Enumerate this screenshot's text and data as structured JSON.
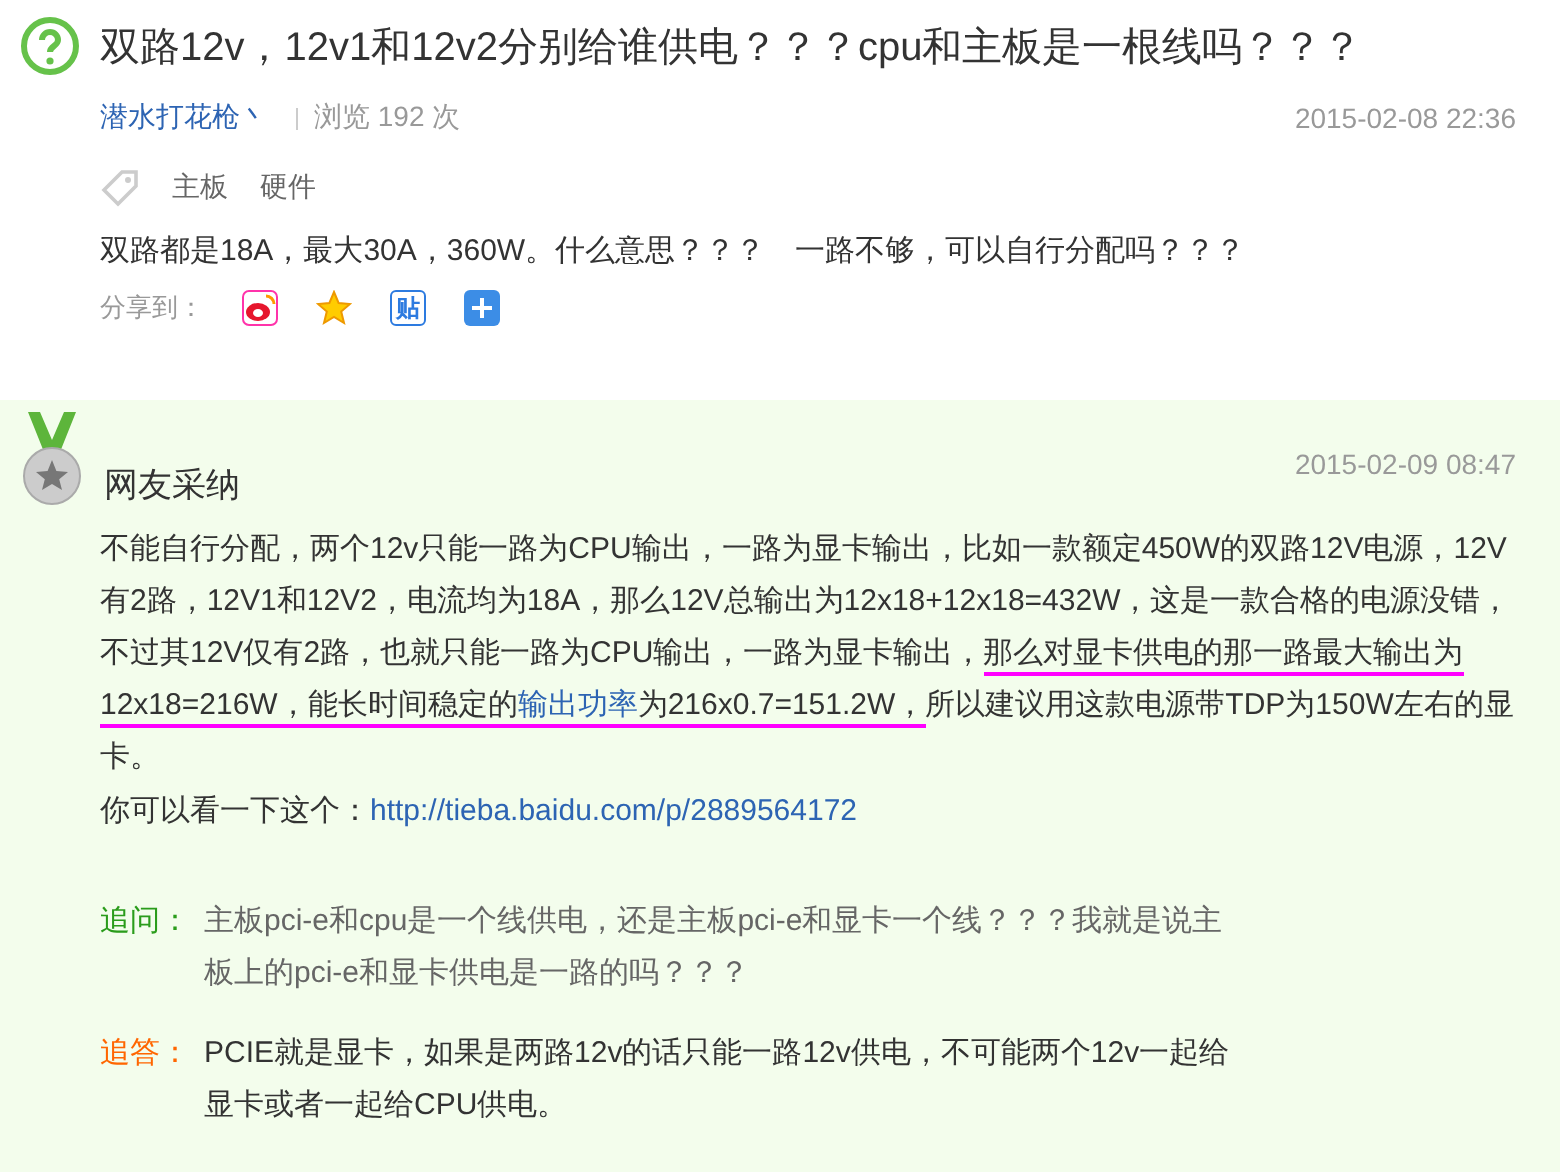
{
  "question": {
    "title": "双路12v，12v1和12v2分别给谁供电？？？cpu和主板是一根线吗？？？",
    "author": "潜水打花枪丶",
    "views": "浏览 192 次",
    "date": "2015-02-08 22:36",
    "tags": [
      "主板",
      "硬件"
    ],
    "text": "双路都是18A，最大30A，360W。什么意思？？？　一路不够，可以自行分配吗？？？",
    "share_label": "分享到：",
    "share": [
      {
        "kind": "weibo"
      },
      {
        "kind": "qzone"
      },
      {
        "kind": "tieba",
        "glyph": "贴"
      },
      {
        "kind": "more"
      }
    ]
  },
  "answer": {
    "heading": "网友采纳",
    "date": "2015-02-09 08:47",
    "segments": [
      {
        "kind": "plain",
        "text": "不能自行分配，两个12v只能一路为CPU输出，一路为显卡输出，比如一款额定450W的双路12V电源，12V有2路，12V1和12V2，电流均为18A，那么12V总输出为12x18+12x18=432W，这是一款合格的电源没错，不过其12V仅有2路，也就只能一路为CPU输出，一路为显卡输出，"
      },
      {
        "kind": "underline",
        "text": "那么对显卡供电的那一路最大输出为12x18=216W，能长时间稳定的"
      },
      {
        "kind": "underline_link",
        "text": "输出功率"
      },
      {
        "kind": "underline",
        "text": "为216x0.7=151.2W，"
      },
      {
        "kind": "plain",
        "text": "所以建议用这款电源带TDP为150W左右的显卡。"
      }
    ],
    "link_intro": "你可以看一下这个：",
    "link": "http://tieba.baidu.com/p/2889564172",
    "followups": [
      {
        "kind": "ask",
        "label": "追问：",
        "text": "主板pci-e和cpu是一个线供电，还是主板pci-e和显卡一个线？？？我就是说主板上的pci-e和显卡供电是一路的吗？？？"
      },
      {
        "kind": "reply",
        "label": "追答：",
        "text": "PCIE就是显卡，如果是两路12v的话只能一路12v供电，不可能两个12v一起给显卡或者一起给CPU供电。"
      }
    ]
  }
}
